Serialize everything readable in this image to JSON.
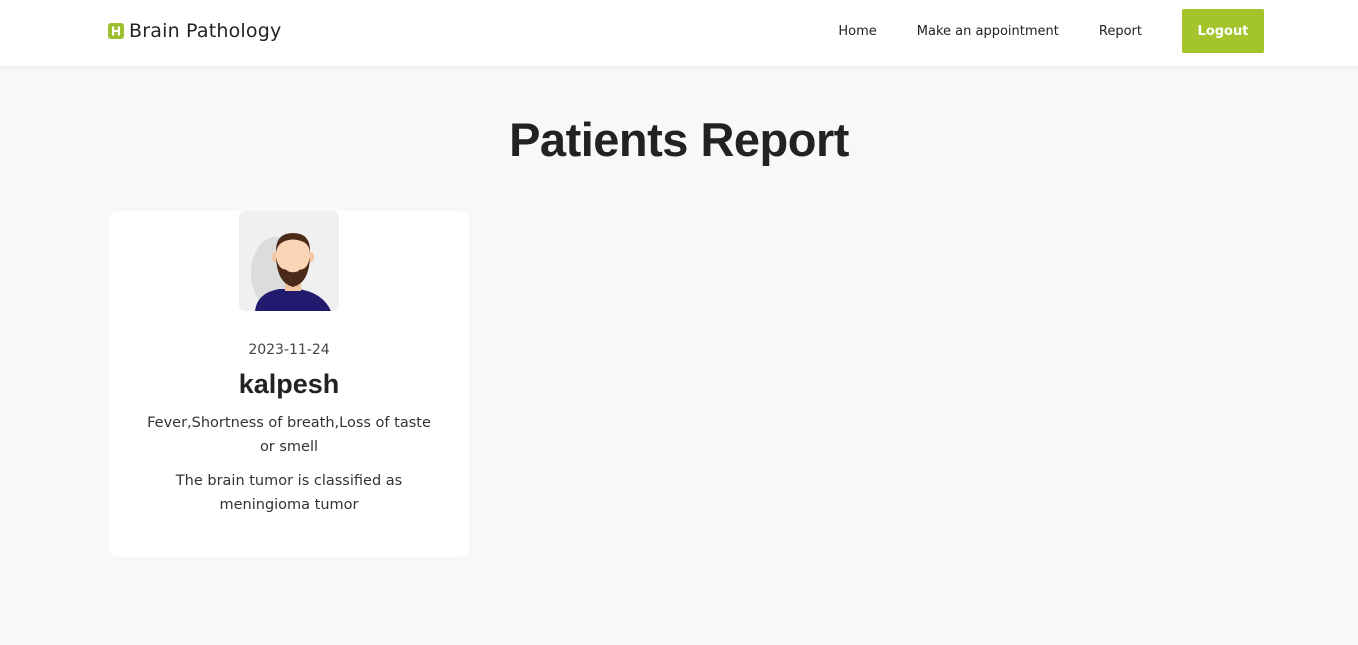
{
  "header": {
    "brand_name": "Brain Pathology",
    "brand_icon": "hospital-h-icon",
    "nav": {
      "home": "Home",
      "appointment": "Make an appointment",
      "report": "Report",
      "logout": "Logout"
    },
    "accent_color": "#a3c42a"
  },
  "page": {
    "title": "Patients Report"
  },
  "reports": [
    {
      "avatar": "bearded-man-avatar",
      "date": "2023-11-24",
      "name": "kalpesh",
      "symptoms": "Fever,Shortness of breath,Loss of taste or smell",
      "diagnosis": "The brain tumor is classified as meningioma tumor"
    }
  ]
}
